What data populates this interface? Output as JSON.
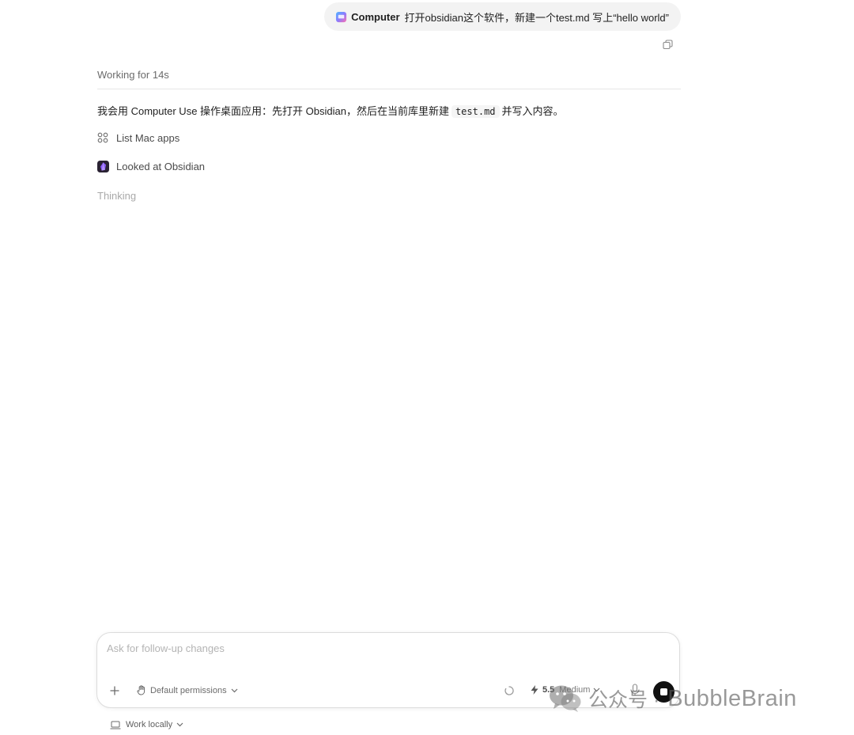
{
  "conversation": {
    "user_message": {
      "app_label": "Computer",
      "text": "打开obsidian这个软件，新建一个test.md 写上“hello world”"
    },
    "working_label": "Working for 14s",
    "assistant_intro_before": "我会用 Computer Use 操作桌面应用：先打开 Obsidian，然后在当前库里新建",
    "assistant_code": "test.md",
    "assistant_intro_after": "并写入内容。",
    "steps": [
      {
        "label": "List Mac apps",
        "icon": "grid-icon"
      },
      {
        "label": "Looked at Obsidian",
        "icon": "obsidian-icon"
      }
    ],
    "thinking_label": "Thinking"
  },
  "composer": {
    "placeholder": "Ask for follow-up changes",
    "value": "",
    "permissions_label": "Default permissions",
    "model_version": "5.5",
    "model_effort": "Medium"
  },
  "footer": {
    "work_locally_label": "Work locally"
  },
  "watermark": {
    "cn": "公众号 ·",
    "en": "BubbleBrain"
  },
  "colors": {
    "bubble_bg": "#f3f3f3",
    "stop_button": "#111111",
    "thinking_text": "#a9a9a9",
    "obsidian_purple": "#6c3fd8"
  }
}
